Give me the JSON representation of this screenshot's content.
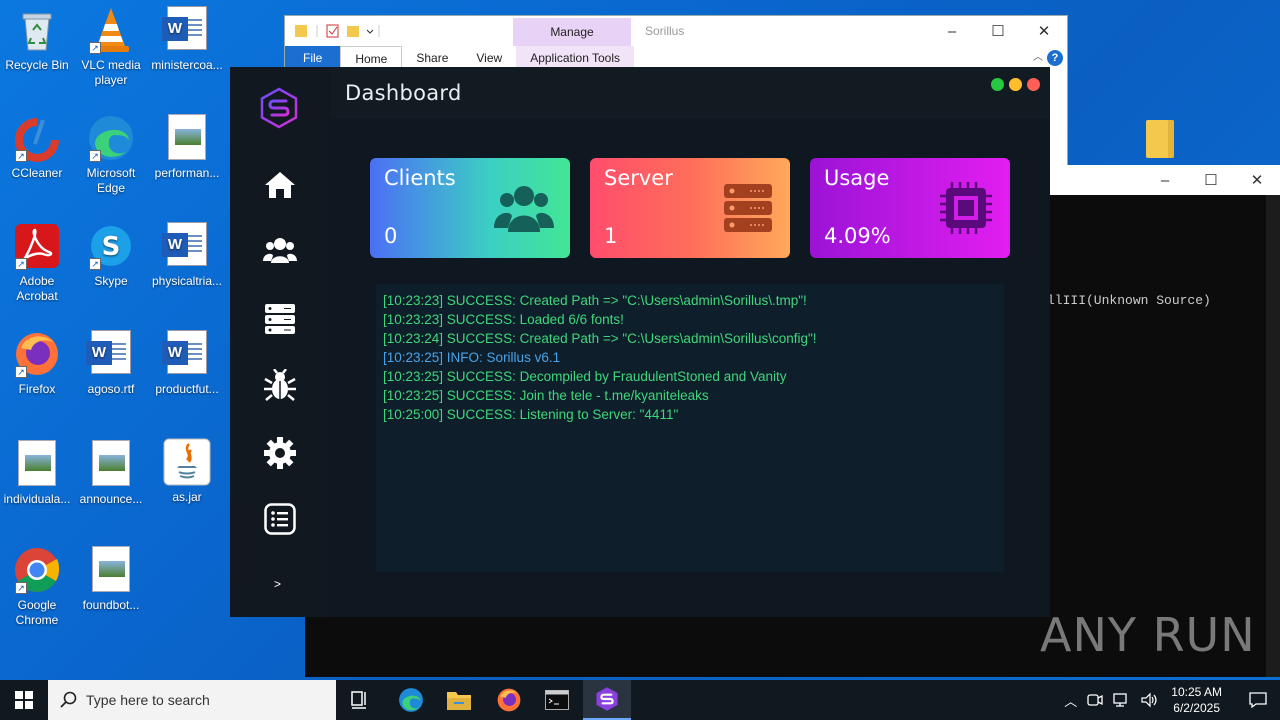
{
  "desktop": {
    "icons": [
      {
        "label": "Recycle Bin"
      },
      {
        "label": "VLC media player"
      },
      {
        "label": "ministercoa..."
      },
      {
        "label": "CCleaner"
      },
      {
        "label": "Microsoft Edge"
      },
      {
        "label": "performan..."
      },
      {
        "label": "Adobe Acrobat"
      },
      {
        "label": "Skype"
      },
      {
        "label": "physicaltria..."
      },
      {
        "label": "Firefox"
      },
      {
        "label": "agoso.rtf"
      },
      {
        "label": "productfut..."
      },
      {
        "label": "individuala..."
      },
      {
        "label": "announce..."
      },
      {
        "label": "as.jar"
      },
      {
        "label": "Google Chrome"
      },
      {
        "label": "foundbot..."
      }
    ]
  },
  "explorer": {
    "title": "Sorillus",
    "manage_tab": "Manage",
    "ribbon": {
      "file": "File",
      "home": "Home",
      "share": "Share",
      "view": "View",
      "app_tools": "Application Tools"
    }
  },
  "console": {
    "text": "llIII(Unknown Source)"
  },
  "app": {
    "title": "Dashboard",
    "cards": {
      "clients": {
        "title": "Clients",
        "value": "0"
      },
      "server": {
        "title": "Server",
        "value": "1"
      },
      "usage": {
        "title": "Usage",
        "value": "4.09%"
      }
    },
    "expand": ">",
    "log": [
      {
        "type": "success",
        "text": "[10:23:23] SUCCESS: Created Path => \"C:\\Users\\admin\\Sorillus\\.tmp\"!"
      },
      {
        "type": "success",
        "text": "[10:23:23] SUCCESS: Loaded 6/6 fonts!"
      },
      {
        "type": "success",
        "text": "[10:23:24] SUCCESS: Created Path => \"C:\\Users\\admin\\Sorillus\\config\"!"
      },
      {
        "type": "info",
        "text": "[10:23:25] INFO: Sorillus v6.1"
      },
      {
        "type": "success",
        "text": "[10:23:25] SUCCESS: Decompiled by FraudulentStoned and Vanity"
      },
      {
        "type": "success",
        "text": "[10:23:25] SUCCESS: Join the tele - t.me/kyaniteleaks"
      },
      {
        "type": "success",
        "text": "[10:25:00] SUCCESS: Listening to Server: \"4411\""
      }
    ]
  },
  "watermark": "ANY RUN",
  "taskbar": {
    "search_placeholder": "Type here to search",
    "time": "10:25 AM",
    "date": "6/2/2025"
  }
}
